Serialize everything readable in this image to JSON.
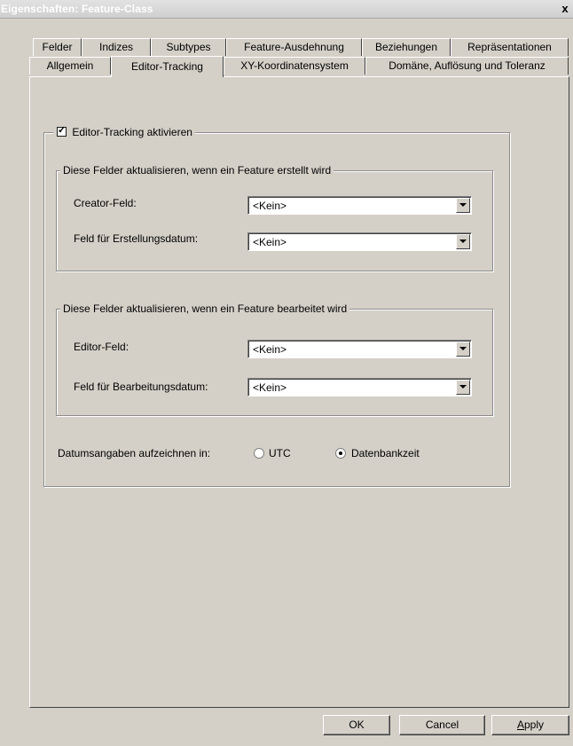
{
  "window": {
    "title": "Eigenschaften: Feature-Class",
    "close_label": "x"
  },
  "tabs_row1": [
    "Felder",
    "Indizes",
    "Subtypes",
    "Feature-Ausdehnung",
    "Beziehungen",
    "Repräsentationen"
  ],
  "tabs_row2": [
    "Allgemein",
    "Editor-Tracking",
    "XY-Koordinatensystem",
    "Domäne, Auflösung und Toleranz"
  ],
  "active_tab": "Editor-Tracking",
  "editor_tracking": {
    "enable_label": "Editor-Tracking aktivieren",
    "enabled": true,
    "create_group": {
      "title": "Diese Felder aktualisieren, wenn ein Feature erstellt wird",
      "creator_label": "Creator-Feld:",
      "creator_value": "<Kein>",
      "create_date_label": "Feld für Erstellungsdatum:",
      "create_date_value": "<Kein>"
    },
    "edit_group": {
      "title": "Diese Felder aktualisieren, wenn ein Feature bearbeitet wird",
      "editor_label": "Editor-Feld:",
      "editor_value": "<Kein>",
      "edit_date_label": "Feld für Bearbeitungsdatum:",
      "edit_date_value": "<Kein>"
    },
    "date_label": "Datumsangaben aufzeichnen in:",
    "date_options": [
      "UTC",
      "Datenbankzeit"
    ],
    "date_selected": "Datenbankzeit"
  },
  "buttons": {
    "ok": "OK",
    "cancel": "Cancel",
    "apply_first": "A",
    "apply_rest": "pply"
  }
}
